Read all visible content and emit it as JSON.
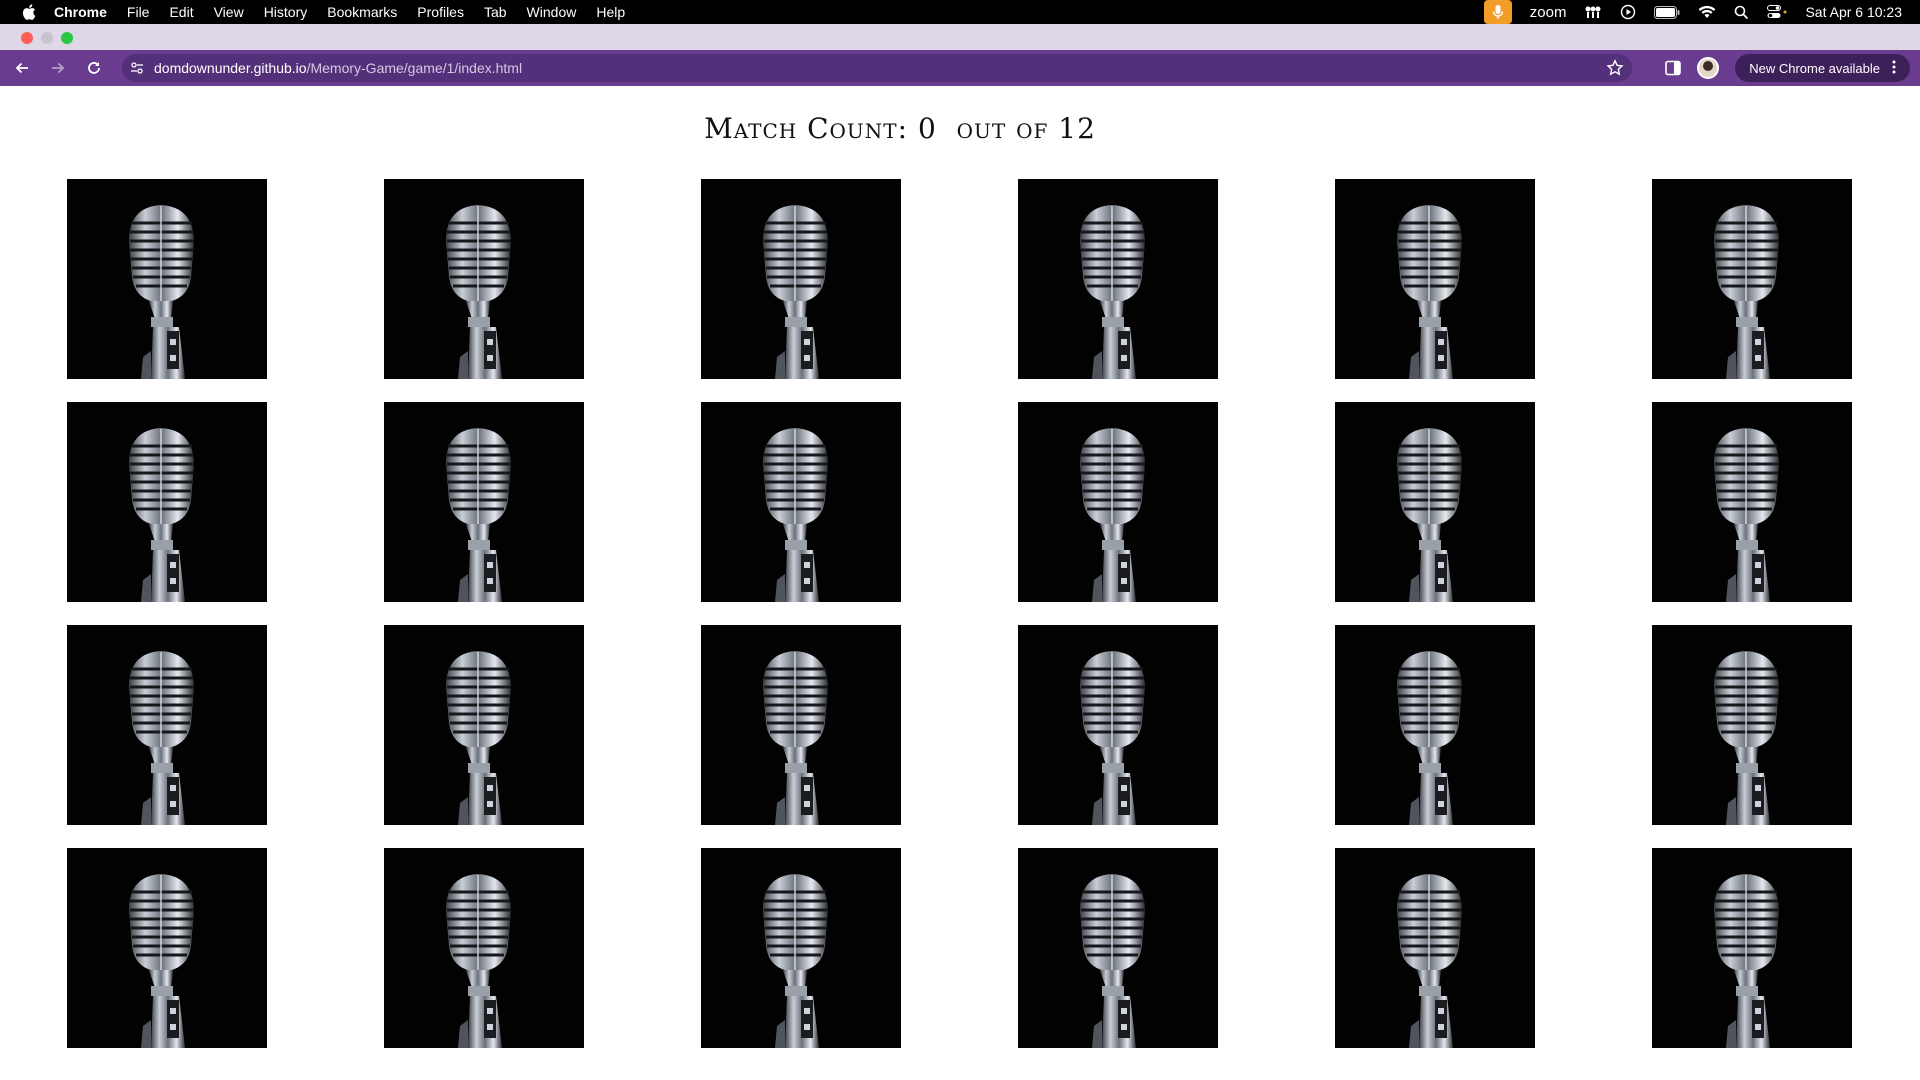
{
  "menubar": {
    "app_name": "Chrome",
    "items": [
      "File",
      "Edit",
      "View",
      "History",
      "Bookmarks",
      "Profiles",
      "Tab",
      "Window",
      "Help"
    ],
    "zoom_label": "zoom",
    "clock": "Sat Apr 6  10:23"
  },
  "browser": {
    "url_host": "domdownunder.github.io",
    "url_path": "/Memory-Game/game/1/index.html",
    "update_label": "New Chrome available",
    "toolbar_color": "#6a3c8f"
  },
  "game": {
    "title_prefix": "Match Count:",
    "match_count": "0",
    "title_middle": "out of",
    "total_pairs": "12",
    "card_back": "microphone-image",
    "rows": 4,
    "columns": 6
  }
}
